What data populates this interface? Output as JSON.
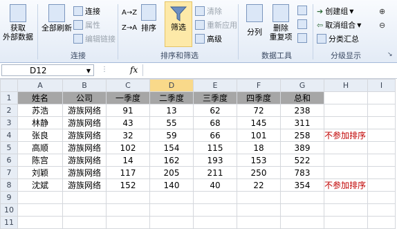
{
  "ribbon": {
    "get_external": "获取\n外部数据",
    "refresh_all": "全部刷新",
    "connections": "连接",
    "properties": "属性",
    "edit_links": "编辑链接",
    "group_connections": "连接",
    "sort_az": "A→Z",
    "sort_za": "Z→A",
    "sort": "排序",
    "filter": "筛选",
    "clear": "清除",
    "reapply": "重新应用",
    "advanced": "高级",
    "group_sort_filter": "排序和筛选",
    "text_to_columns": "分列",
    "remove_duplicates": "删除\n重复项",
    "group_data_tools": "数据工具",
    "group_create": "创建组",
    "ungroup": "取消组合",
    "subtotal": "分类汇总",
    "group_outline": "分级显示"
  },
  "formula_bar": {
    "cell_ref": "D12",
    "fx": "fx",
    "value": ""
  },
  "columns": [
    "A",
    "B",
    "C",
    "D",
    "E",
    "F",
    "G",
    "H",
    "I"
  ],
  "rows": [
    [
      "姓名",
      "公司",
      "一季度",
      "二季度",
      "三季度",
      "四季度",
      "总和",
      "",
      ""
    ],
    [
      "苏浩",
      "游族网络",
      "91",
      "13",
      "62",
      "72",
      "238",
      "",
      ""
    ],
    [
      "林静",
      "游族网络",
      "43",
      "55",
      "68",
      "145",
      "311",
      "",
      ""
    ],
    [
      "张良",
      "游族网络",
      "32",
      "59",
      "66",
      "101",
      "258",
      "不参加排序",
      ""
    ],
    [
      "高顺",
      "游族网络",
      "102",
      "154",
      "115",
      "18",
      "389",
      "",
      ""
    ],
    [
      "陈宫",
      "游族网络",
      "14",
      "162",
      "193",
      "153",
      "522",
      "",
      ""
    ],
    [
      "刘颖",
      "游族网络",
      "117",
      "205",
      "211",
      "250",
      "783",
      "",
      ""
    ],
    [
      "沈斌",
      "游族网络",
      "152",
      "140",
      "40",
      "22",
      "354",
      "不参加排序",
      ""
    ],
    [
      "",
      "",
      "",
      "",
      "",
      "",
      "",
      "",
      ""
    ],
    [
      "",
      "",
      "",
      "",
      "",
      "",
      "",
      "",
      ""
    ],
    [
      "",
      "",
      "",
      "",
      "",
      "",
      "",
      "",
      ""
    ]
  ],
  "row_numbers": [
    "1",
    "2",
    "3",
    "4",
    "5",
    "6",
    "7",
    "8",
    "9",
    "10",
    "11"
  ],
  "selected_column": "D",
  "selected_row": "12",
  "accent_color": "#f9d98a",
  "note_color": "#c00000"
}
